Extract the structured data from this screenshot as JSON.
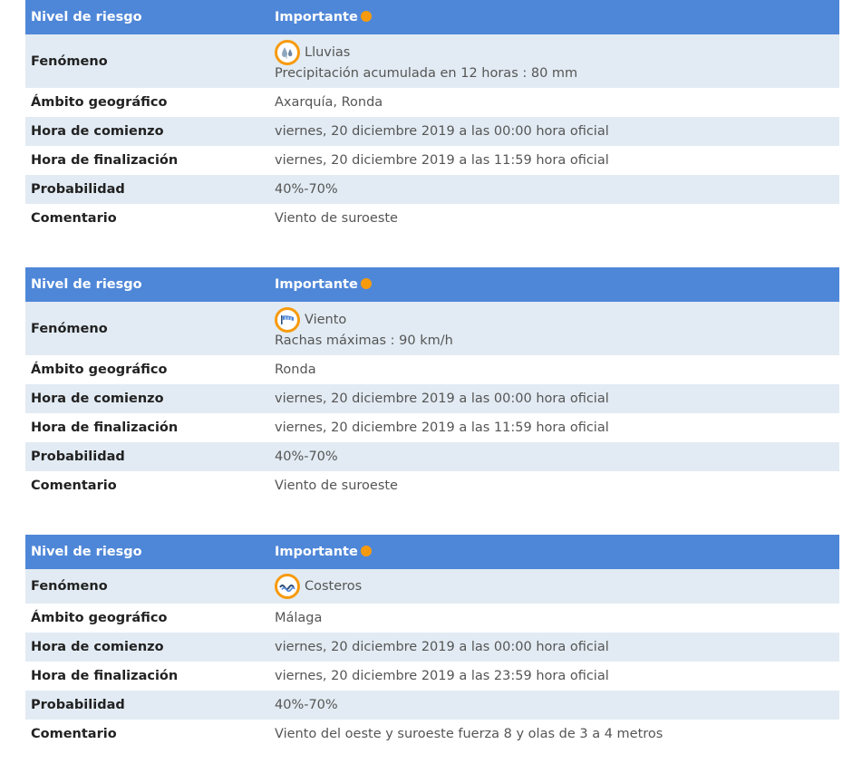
{
  "colors": {
    "header_bg": "#4f87d8",
    "alt_row_bg": "#e2ebf3",
    "risk_important": "#f79a0d",
    "label_text": "#222222",
    "value_text": "#555555"
  },
  "labels": {
    "risk_level": "Nivel de riesgo",
    "phenomenon": "Fenómeno",
    "area": "Ámbito geográfico",
    "start": "Hora de comienzo",
    "end": "Hora de finalización",
    "probability": "Probabilidad",
    "comment": "Comentario"
  },
  "warnings": [
    {
      "risk_level": "Importante",
      "phenomenon": "Lluvias",
      "phenomenon_icon": "rain-drops-icon",
      "detail": "Precipitación acumulada en 12 horas : 80 mm",
      "area": "Axarquía, Ronda",
      "start": "viernes, 20 diciembre 2019 a las 00:00 hora oficial",
      "end": "viernes, 20 diciembre 2019 a las 11:59 hora oficial",
      "probability": "40%-70%",
      "comment": "Viento de suroeste"
    },
    {
      "risk_level": "Importante",
      "phenomenon": "Viento",
      "phenomenon_icon": "wind-flag-icon",
      "detail": "Rachas máximas : 90 km/h",
      "area": "Ronda",
      "start": "viernes, 20 diciembre 2019 a las 00:00 hora oficial",
      "end": "viernes, 20 diciembre 2019 a las 11:59 hora oficial",
      "probability": "40%-70%",
      "comment": "Viento de suroeste"
    },
    {
      "risk_level": "Importante",
      "phenomenon": "Costeros",
      "phenomenon_icon": "coastal-waves-icon",
      "detail": "",
      "area": "Málaga",
      "start": "viernes, 20 diciembre 2019 a las 00:00 hora oficial",
      "end": "viernes, 20 diciembre 2019 a las 23:59 hora oficial",
      "probability": "40%-70%",
      "comment": "Viento del oeste y suroeste fuerza 8 y olas de 3 a 4 metros"
    }
  ]
}
